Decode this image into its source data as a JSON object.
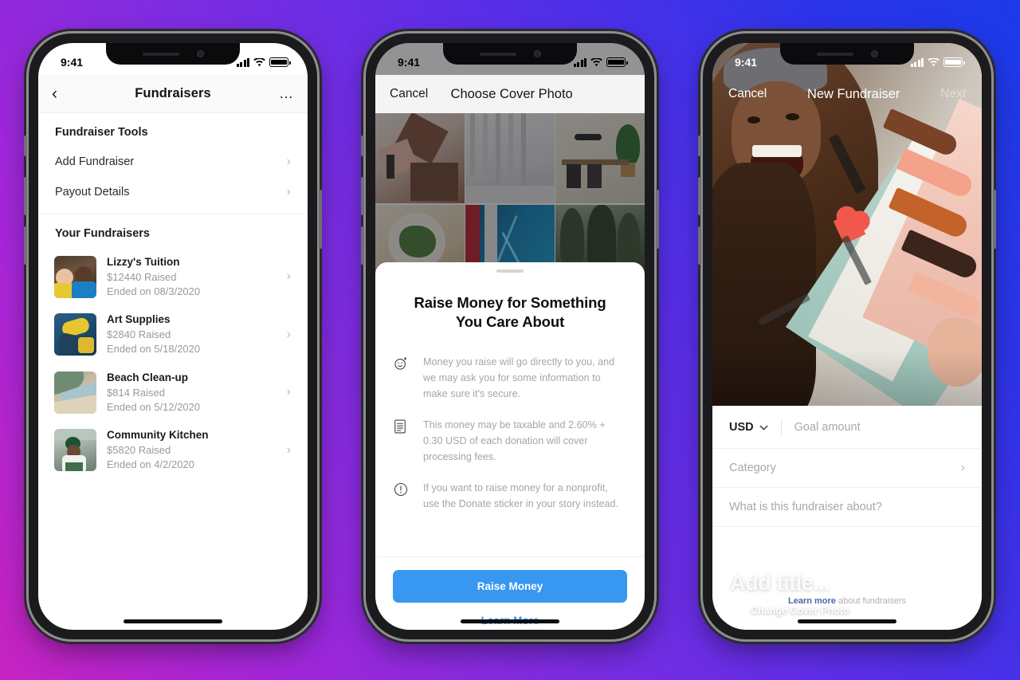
{
  "background": {
    "from": "#c623c0",
    "to": "#1b3ae8"
  },
  "status_bar": {
    "time": "9:41",
    "signal_icon": "cellular-bars-icon",
    "wifi_icon": "wifi-icon",
    "battery_icon": "battery-icon"
  },
  "phone1": {
    "nav": {
      "back_icon": "chevron-left-icon",
      "title": "Fundraisers",
      "more_icon": "ellipsis-icon"
    },
    "tools_section_title": "Fundraiser Tools",
    "tools": [
      {
        "label": "Add Fundraiser",
        "chevron": "chevron-right-icon"
      },
      {
        "label": "Payout Details",
        "chevron": "chevron-right-icon"
      }
    ],
    "your_section_title": "Your Fundraisers",
    "fundraisers": [
      {
        "title": "Lizzy's Tuition",
        "raised": "$12440 Raised",
        "ended": "Ended on 08/3/2020"
      },
      {
        "title": "Art Supplies",
        "raised": "$2840 Raised",
        "ended": "Ended on 5/18/2020"
      },
      {
        "title": "Beach Clean-up",
        "raised": "$814 Raised",
        "ended": "Ended on 5/12/2020"
      },
      {
        "title": "Community Kitchen",
        "raised": "$5820 Raised",
        "ended": "Ended on 4/2/2020"
      }
    ]
  },
  "phone2": {
    "nav": {
      "cancel": "Cancel",
      "title": "Choose Cover Photo"
    },
    "sheet": {
      "heading": "Raise Money for Something You Care About",
      "bullets": [
        {
          "icon": "smiley-sparkle-icon",
          "text": "Money you raise will go directly to you, and we may ask you for some information to make sure it's secure."
        },
        {
          "icon": "document-icon",
          "text": "This money may be taxable and 2.60% + 0.30 USD of each donation will cover processing fees."
        },
        {
          "icon": "exclamation-circle-icon",
          "text": "If you want to raise money for a nonprofit, use the Donate sticker in your story instead."
        }
      ],
      "primary_button": "Raise Money",
      "secondary_link": "Learn More",
      "accent_color": "#3897f0"
    }
  },
  "phone3": {
    "nav": {
      "cancel": "Cancel",
      "title": "New Fundraiser",
      "next": "Next"
    },
    "cover": {
      "title_placeholder": "Add title...",
      "change_photo": "Change Cover Photo",
      "photo_icon": "photo-icon"
    },
    "form": {
      "currency": "USD",
      "currency_chevron": "chevron-down-icon",
      "goal_placeholder": "Goal amount",
      "category_label": "Category",
      "category_chevron": "chevron-right-icon",
      "about_placeholder": "What is this fundraiser about?"
    },
    "footer": {
      "link": "Learn more",
      "rest": " about fundraisers",
      "link_color": "#4a6aa5"
    }
  }
}
